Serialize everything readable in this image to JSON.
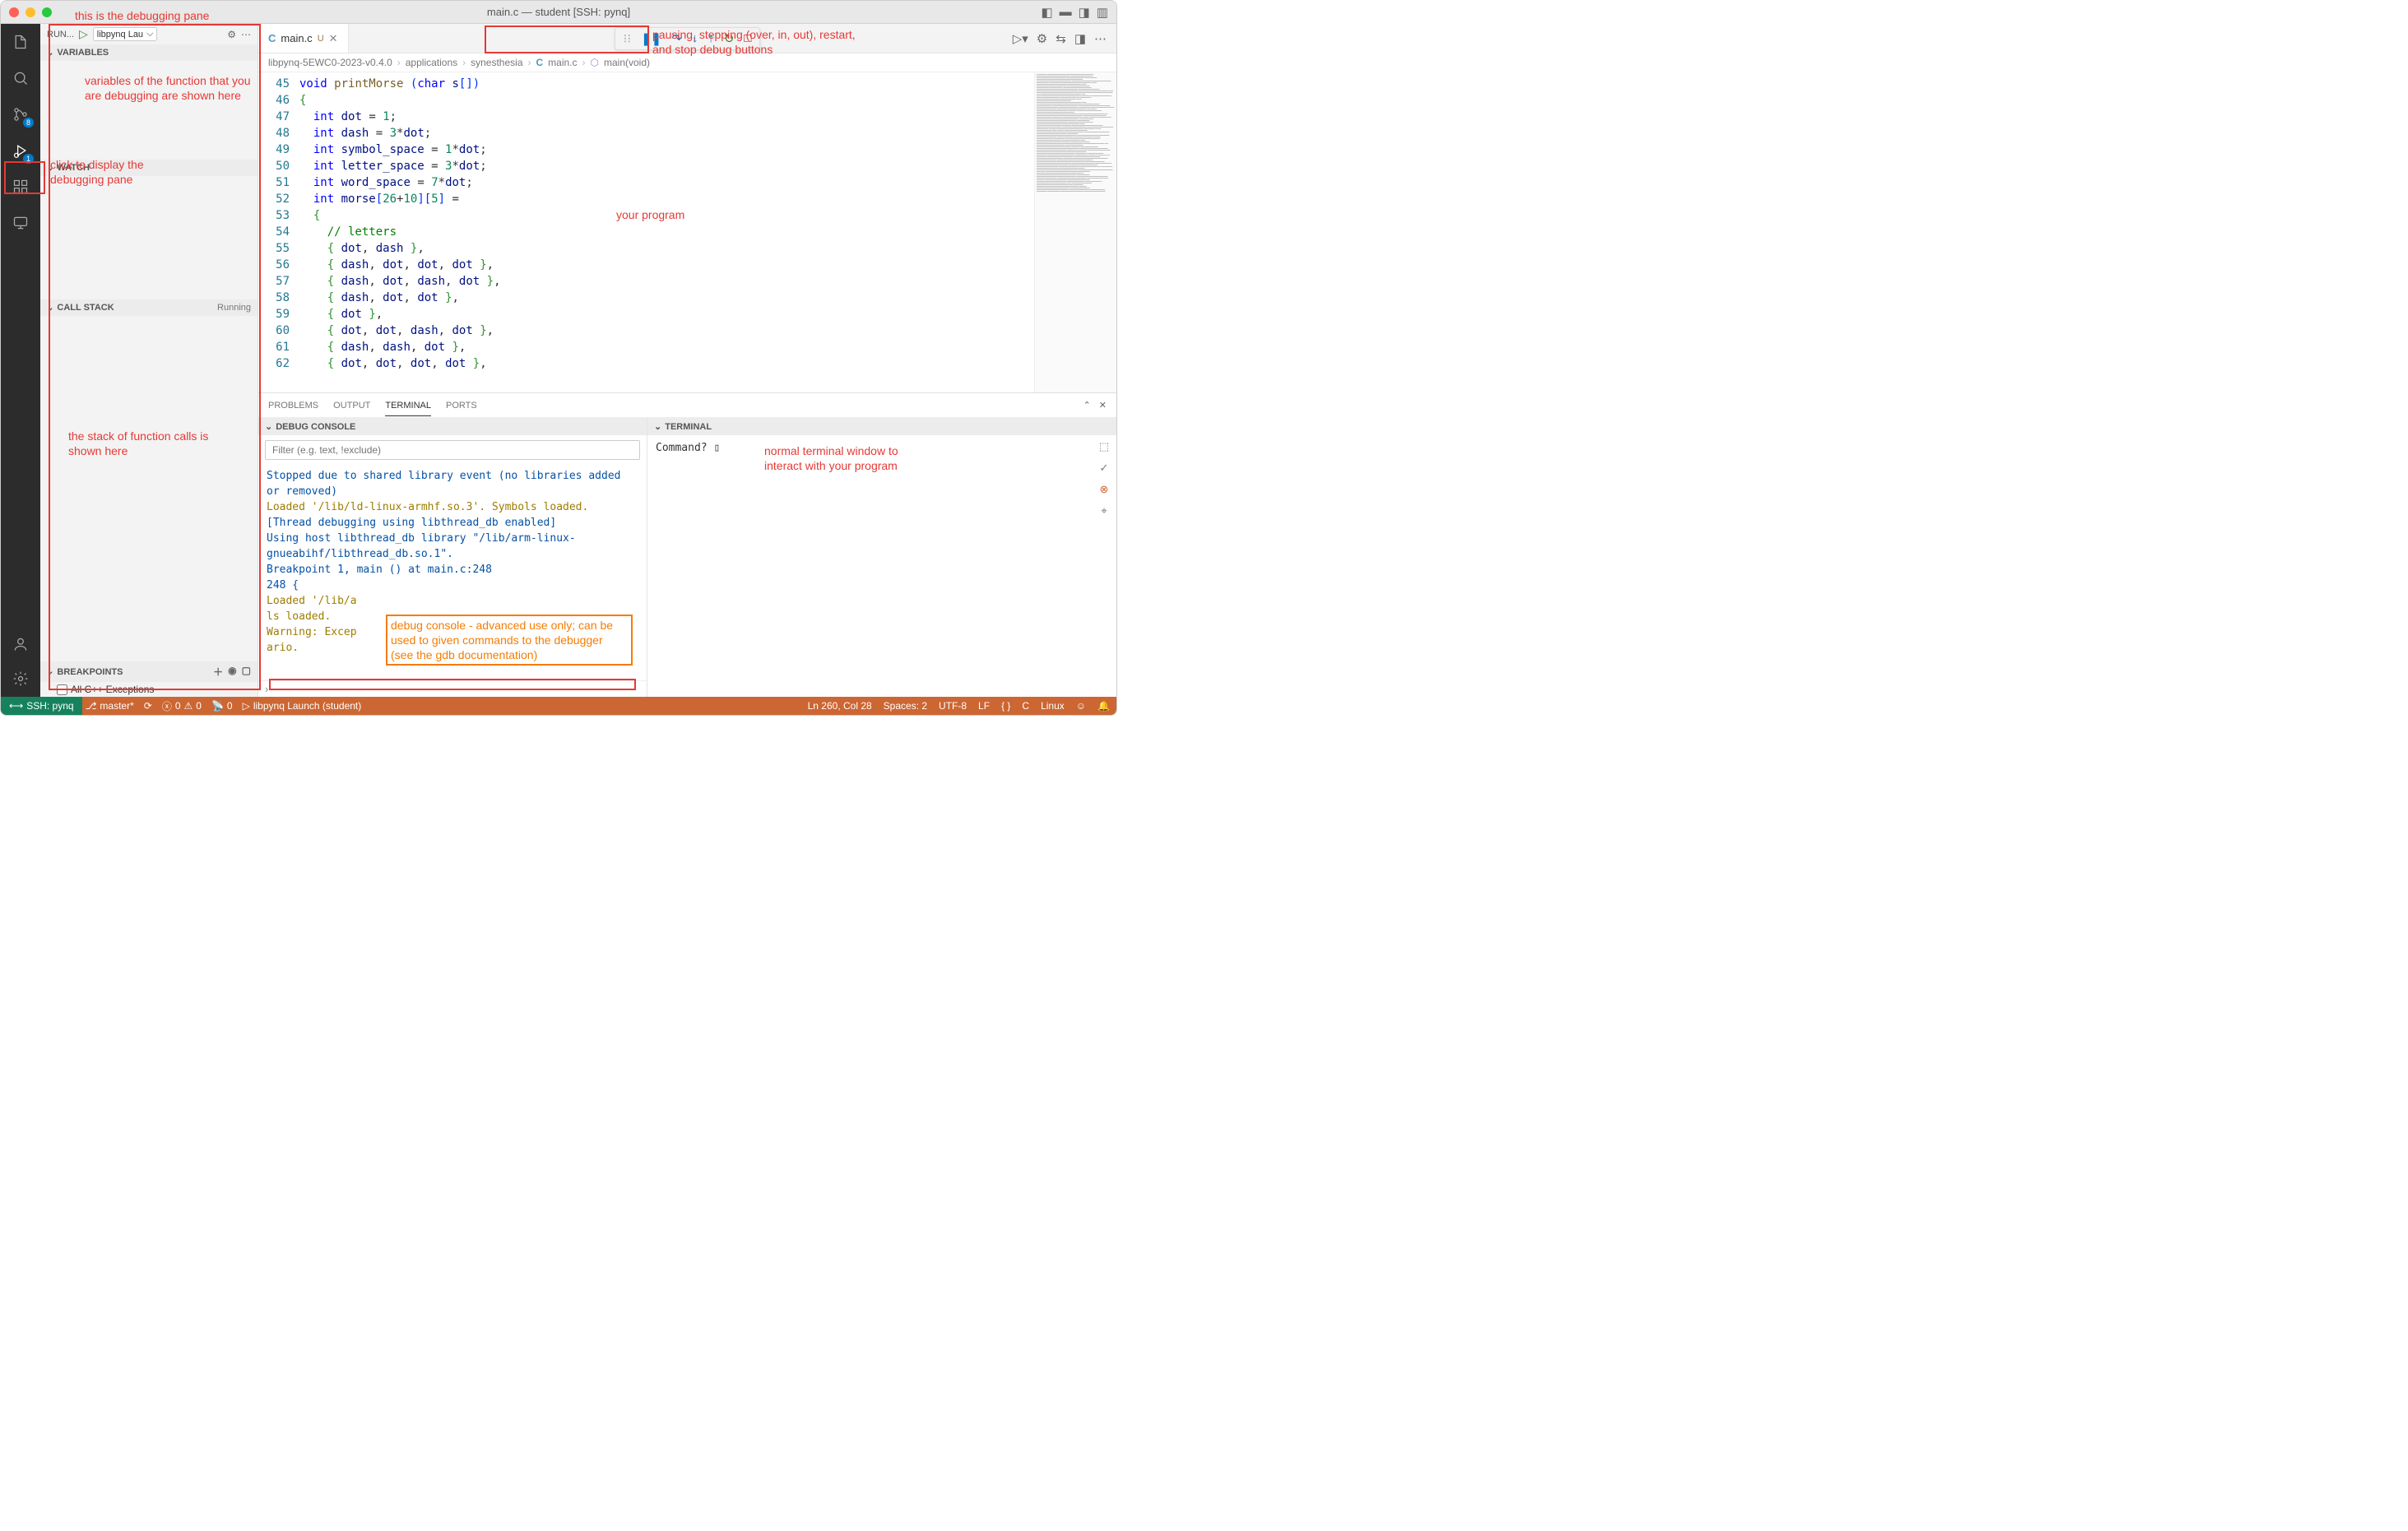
{
  "window": {
    "title": "main.c — student [SSH: pynq]"
  },
  "activitybar": {
    "scm_badge": "8",
    "debug_badge": "1"
  },
  "sidebar": {
    "run_label": "RUN...",
    "config_name": "libpynq Lau",
    "variables_label": "VARIABLES",
    "watch_label": "WATCH",
    "callstack_label": "CALL STACK",
    "callstack_status": "Running",
    "breakpoints_label": "BREAKPOINTS",
    "bp_all_cpp": "All C++ Exceptions"
  },
  "tabs": {
    "file_icon": "C",
    "file_name": "main.c",
    "modified": "U"
  },
  "breadcrumb": {
    "p0": "libpynq-5EWC0-2023-v0.4.0",
    "p1": "applications",
    "p2": "synesthesia",
    "p3_icon": "C",
    "p3": "main.c",
    "p4": "main(void)"
  },
  "editor": {
    "lines": [
      {
        "n": 45,
        "html": "<span class='type'>void</span> <span class='fn'>printMorse</span> <span class='paren'>(</span><span class='type'>char</span> <span class='var'>s</span><span class='sqbr'>[]</span><span class='paren'>)</span>"
      },
      {
        "n": 46,
        "html": "<span class='brace'>{</span>"
      },
      {
        "n": 47,
        "html": "  <span class='type'>int</span> <span class='var'>dot</span> = <span class='num'>1</span>;"
      },
      {
        "n": 48,
        "html": "  <span class='type'>int</span> <span class='var'>dash</span> = <span class='num'>3</span>*<span class='var'>dot</span>;"
      },
      {
        "n": 49,
        "html": "  <span class='type'>int</span> <span class='var'>symbol_space</span> = <span class='num'>1</span>*<span class='var'>dot</span>;"
      },
      {
        "n": 50,
        "html": "  <span class='type'>int</span> <span class='var'>letter_space</span> = <span class='num'>3</span>*<span class='var'>dot</span>;"
      },
      {
        "n": 51,
        "html": "  <span class='type'>int</span> <span class='var'>word_space</span> = <span class='num'>7</span>*<span class='var'>dot</span>;"
      },
      {
        "n": 52,
        "html": "  <span class='type'>int</span> <span class='var'>morse</span><span class='sqbr'>[</span><span class='num'>26</span>+<span class='num'>10</span><span class='sqbr'>]</span><span class='sqbr'>[</span><span class='num'>5</span><span class='sqbr'>]</span> ="
      },
      {
        "n": 53,
        "html": "  <span class='brace'>{</span>"
      },
      {
        "n": 54,
        "html": "    <span class='comment'>// letters</span>"
      },
      {
        "n": 55,
        "html": "    <span class='brace'>{</span> <span class='var'>dot</span>, <span class='var'>dash</span> <span class='brace'>}</span>,"
      },
      {
        "n": 56,
        "html": "    <span class='brace'>{</span> <span class='var'>dash</span>, <span class='var'>dot</span>, <span class='var'>dot</span>, <span class='var'>dot</span> <span class='brace'>}</span>,"
      },
      {
        "n": 57,
        "html": "    <span class='brace'>{</span> <span class='var'>dash</span>, <span class='var'>dot</span>, <span class='var'>dash</span>, <span class='var'>dot</span> <span class='brace'>}</span>,"
      },
      {
        "n": 58,
        "html": "    <span class='brace'>{</span> <span class='var'>dash</span>, <span class='var'>dot</span>, <span class='var'>dot</span> <span class='brace'>}</span>,"
      },
      {
        "n": 59,
        "html": "    <span class='brace'>{</span> <span class='var'>dot</span> <span class='brace'>}</span>,"
      },
      {
        "n": 60,
        "html": "    <span class='brace'>{</span> <span class='var'>dot</span>, <span class='var'>dot</span>, <span class='var'>dash</span>, <span class='var'>dot</span> <span class='brace'>}</span>,"
      },
      {
        "n": 61,
        "html": "    <span class='brace'>{</span> <span class='var'>dash</span>, <span class='var'>dash</span>, <span class='var'>dot</span> <span class='brace'>}</span>,"
      },
      {
        "n": 62,
        "html": "    <span class='brace'>{</span> <span class='var'>dot</span>, <span class='var'>dot</span>, <span class='var'>dot</span>, <span class='var'>dot</span> <span class='brace'>}</span>,"
      }
    ]
  },
  "panel": {
    "tabs": {
      "problems": "PROBLEMS",
      "output": "OUTPUT",
      "terminal": "TERMINAL",
      "ports": "PORTS"
    },
    "debug_console_label": "DEBUG CONSOLE",
    "filter_placeholder": "Filter (e.g. text, !exclude)",
    "dc_lines": [
      {
        "cls": "dc-blue",
        "t": "Stopped due to shared library event (no libraries added or removed)"
      },
      {
        "cls": "dc-gold",
        "t": "Loaded '/lib/ld-linux-armhf.so.3'. Symbols loaded."
      },
      {
        "cls": "dc-blue",
        "t": "[Thread debugging using libthread_db enabled]"
      },
      {
        "cls": "dc-blue",
        "t": "Using host libthread_db library \"/lib/arm-linux-gnueabihf/libthread_db.so.1\"."
      },
      {
        "cls": "",
        "t": " "
      },
      {
        "cls": "dc-blue",
        "t": "Breakpoint 1, main () at main.c:248"
      },
      {
        "cls": "dc-blue",
        "t": "248     {"
      },
      {
        "cls": "dc-gold",
        "t": "Loaded '/lib/a"
      },
      {
        "cls": "dc-gold",
        "t": "ls loaded."
      },
      {
        "cls": "dc-gold",
        "t": "Warning: Excep"
      },
      {
        "cls": "dc-gold",
        "t": "ario."
      }
    ],
    "terminal_label": "TERMINAL",
    "terminal_prompt": "Command? ▯"
  },
  "statusbar": {
    "ssh": "SSH: pynq",
    "branch": "master*",
    "errors": "0",
    "warnings": "0",
    "ports": "0",
    "launch": "libpynq Launch (student)",
    "cursor": "Ln 260, Col 28",
    "spaces": "Spaces: 2",
    "encoding": "UTF-8",
    "eol": "LF",
    "lang_brace": "{ }",
    "lang": "C",
    "os": "Linux"
  },
  "annotations": {
    "debugging_pane": "this is the debugging pane",
    "variables_note": "variables        of the function that you are debugging are shown here",
    "click_debug": "click to display the debugging pane",
    "debug_buttons": "pausing, stepping (over, in, out), restart, and stop debug buttons",
    "your_program": "your program",
    "call_stack_note": "the stack of function calls is shown here",
    "terminal_note": "normal terminal window to interact with your program",
    "debug_console_note": "debug console - advanced use only; can be used to given commands to the debugger (see the gdb documentation)"
  }
}
